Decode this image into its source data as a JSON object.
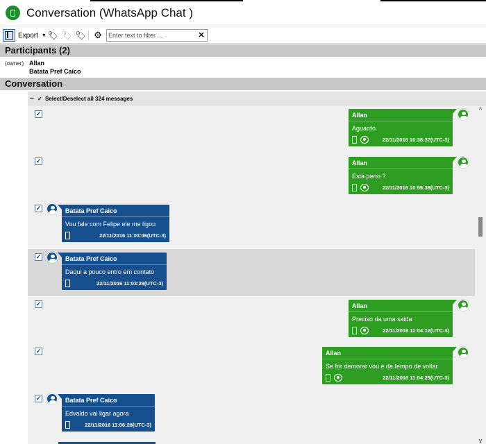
{
  "window": {
    "title": "Conversation (WhatsApp Chat )",
    "app_icon": "whatsapp-phone-icon"
  },
  "toolbar": {
    "export_label": "Export",
    "filter_placeholder": "Enter text to filter ...",
    "filter_value": "",
    "clear_glyph": "✕",
    "icons": [
      "panel-toggle-icon",
      "tag-icon",
      "tag-remove-icon",
      "tag-add-icon",
      "gear-icon"
    ]
  },
  "participants": {
    "header": "Participants (2)",
    "owner_tag": "(owner)",
    "list": [
      "Allan",
      "Batata Pref Caico"
    ]
  },
  "conversation": {
    "header": "Conversation",
    "select_all_label": "Select/Deselect all 324 messages",
    "messages": [
      {
        "direction": "out",
        "sender": "Allan",
        "text": "Aguardo",
        "timestamp": "22/11/2016 10:38:37(UTC-3)",
        "checked": true,
        "group_icon": true
      },
      {
        "direction": "out",
        "sender": "Allan",
        "text": "Está perto ?",
        "timestamp": "22/11/2016 10:59:38(UTC-3)",
        "checked": true,
        "group_icon": true
      },
      {
        "direction": "in",
        "sender": "Batata Pref Caico",
        "text": "Vou fale com Felipe  ele me ligou",
        "timestamp": "22/11/2016 11:03:06(UTC-3)",
        "checked": true,
        "group_icon": false
      },
      {
        "direction": "in",
        "sender": "Batata Pref Caico",
        "text": "Daqui a pouco entro em contato",
        "timestamp": "22/11/2016 11:03:29(UTC-3)",
        "checked": true,
        "group_icon": false,
        "highlighted": true
      },
      {
        "direction": "out",
        "sender": "Allan",
        "text": "Preciso da uma saida",
        "timestamp": "22/11/2016 11:04:12(UTC-3)",
        "checked": true,
        "group_icon": true
      },
      {
        "direction": "out",
        "sender": "Allan",
        "text": "Se for demorar vou e da tempo de voltar",
        "timestamp": "22/11/2016 11:04:25(UTC-3)",
        "checked": true,
        "group_icon": true
      },
      {
        "direction": "in",
        "sender": "Batata Pref Caico",
        "text": "Edvaldo vai ligar agora",
        "timestamp": "22/11/2016 11:06:28(UTC-3)",
        "checked": true,
        "group_icon": false
      }
    ]
  },
  "colors": {
    "outgoing_bubble": "#2e9e23",
    "incoming_bubble": "#154f8e",
    "section_header": "#c8c8c8",
    "highlight_row": "#d9d9d9"
  }
}
